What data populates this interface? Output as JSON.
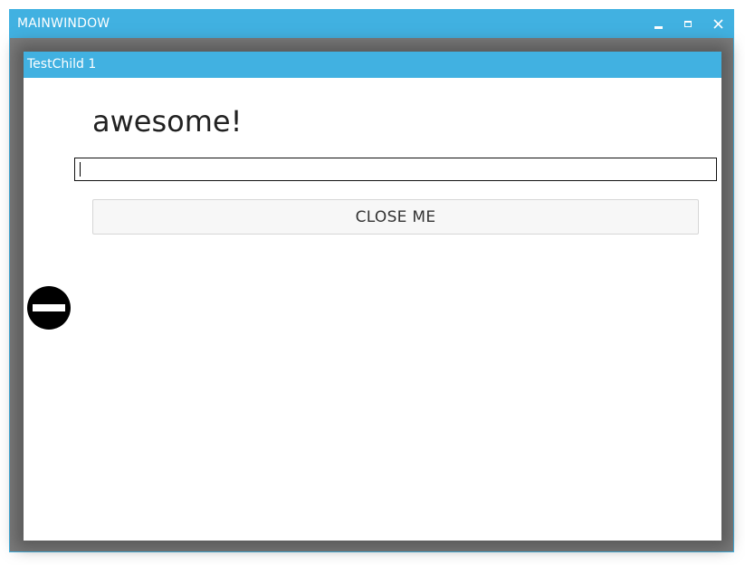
{
  "main_window": {
    "title": "MAINWINDOW",
    "minimize_icon": "minimize-icon",
    "maximize_icon": "maximize-icon",
    "close_icon": "close-icon"
  },
  "child_window": {
    "title": "TestChild 1",
    "heading": "awesome!",
    "input": {
      "value": "",
      "placeholder": ""
    },
    "close_button_label": "CLOSE ME",
    "status_icon": "no-entry-icon"
  },
  "colors": {
    "accent": "#41b1e1",
    "overlay": "#7b7b7b",
    "button_bg": "#f7f7f7"
  }
}
